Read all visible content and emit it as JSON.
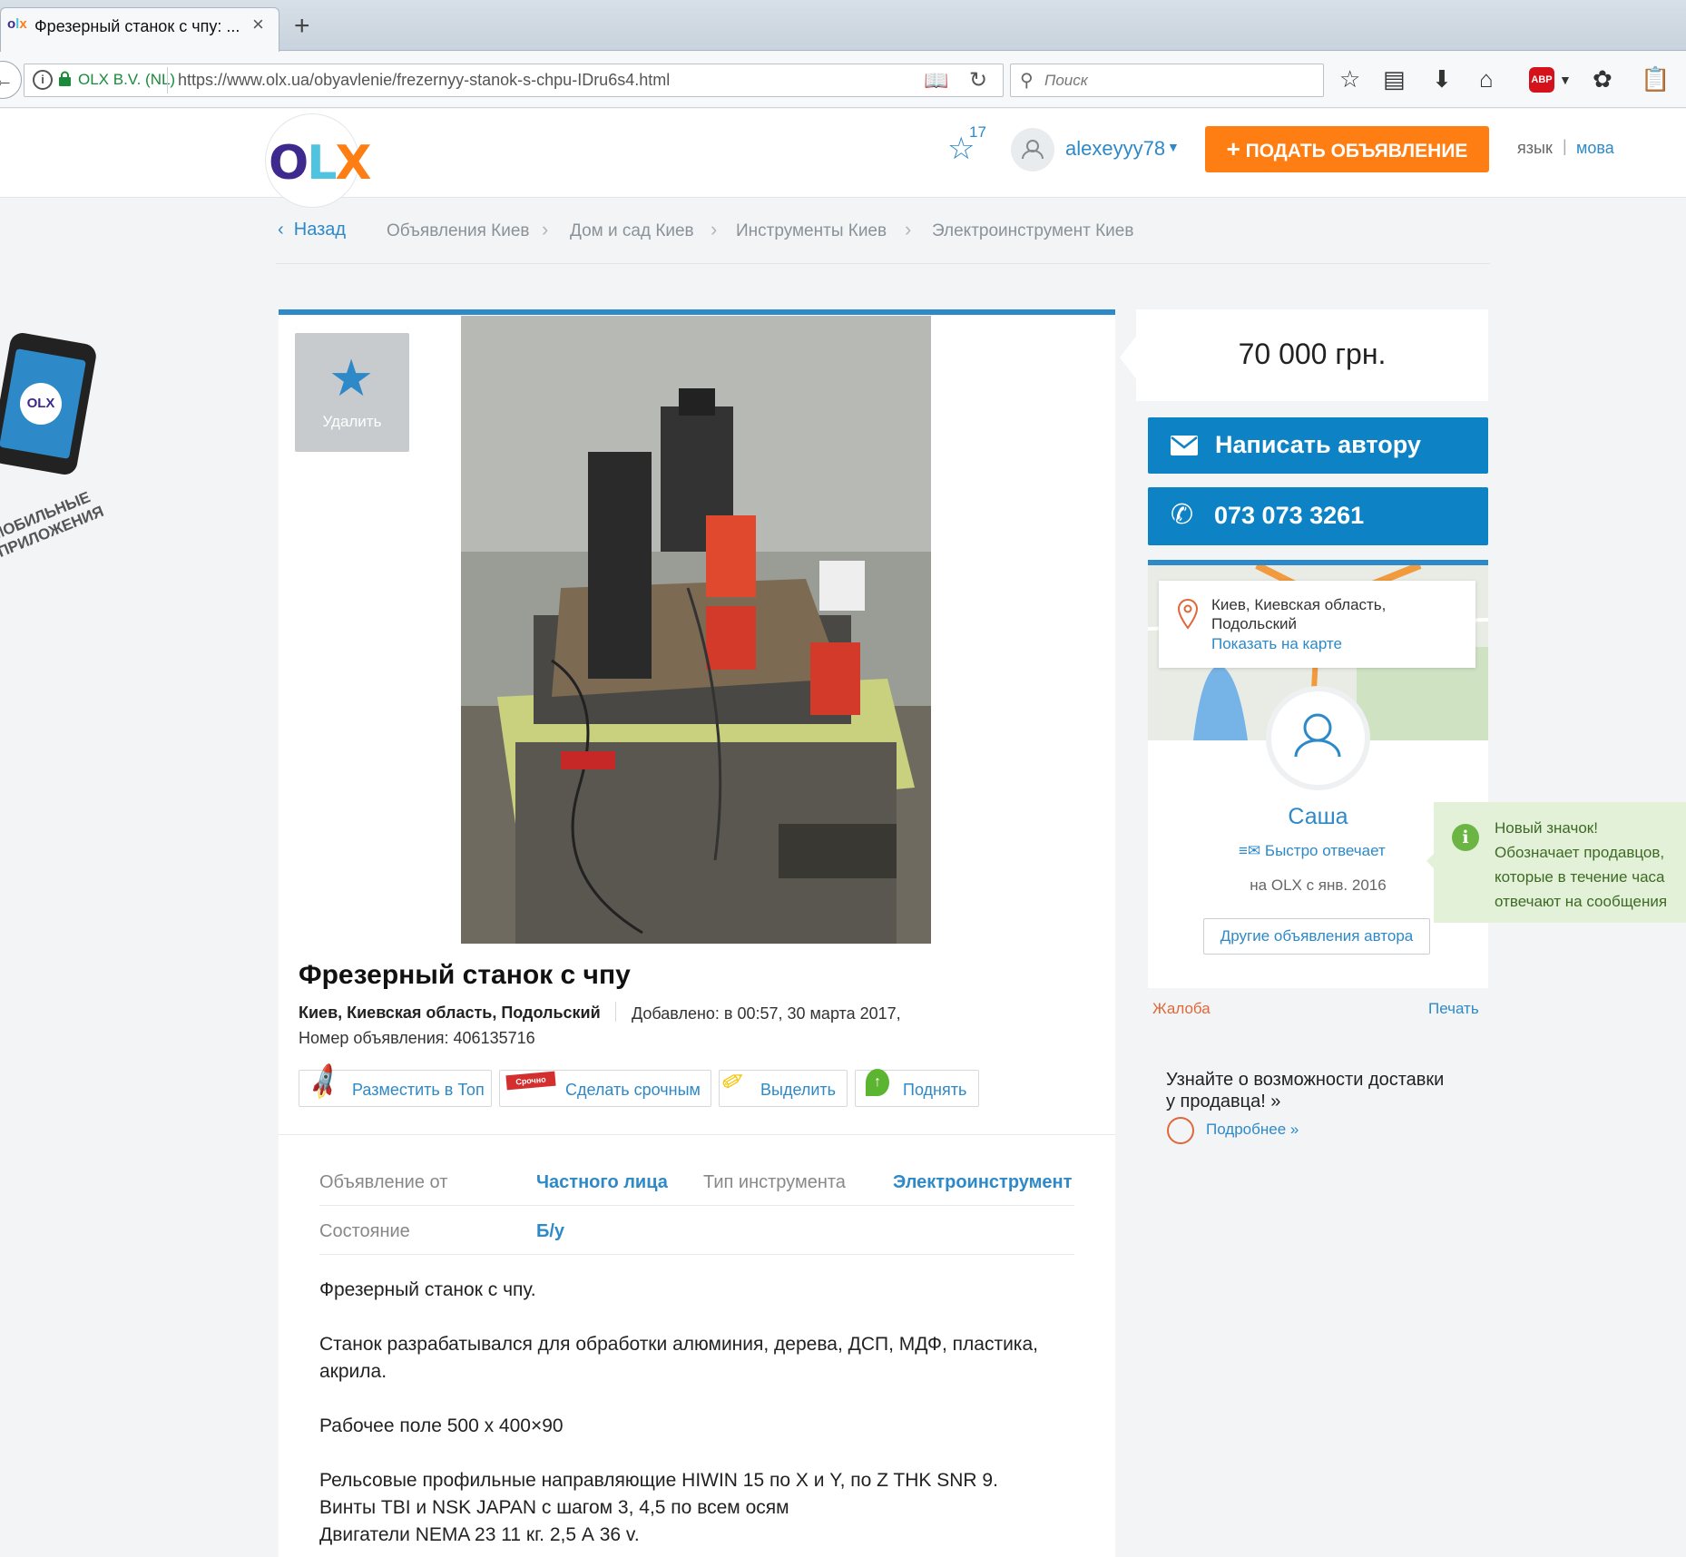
{
  "browser": {
    "tab_title": "Фрезерный станок с чпу: ...",
    "tab_favicon": "olx",
    "close_glyph": "×",
    "newtab_glyph": "+",
    "site_identity": "OLX B.V. (NL)",
    "url": "https://www.olx.ua/obyavlenie/frezernyy-stanok-s-chpu-IDru6s4.html",
    "search_placeholder": "Поиск"
  },
  "header": {
    "logo": {
      "o": "O",
      "l": "L",
      "x": "X",
      "colors": [
        "#3e2a8e",
        "#4fc3e0",
        "#ff7e14"
      ]
    },
    "favorites_count": "17",
    "username": "alexeyyy78",
    "post_button": "ПОДАТЬ ОБЪЯВЛЕНИЕ",
    "lang_ru": "язык",
    "lang_sep": "|",
    "lang_ua": "мова"
  },
  "breadcrumb": {
    "back": "Назад",
    "items": [
      "Объявления Киев",
      "Дом и сад Киев",
      "Инструменты Киев",
      "Электроинструмент Киев"
    ]
  },
  "promo": {
    "app_text": "МОБИЛЬНЫЕ ПРИЛОЖЕНИЯ",
    "logo_text": "OLX"
  },
  "ad": {
    "favorite_label": "Удалить",
    "title": "Фрезерный станок с чпу",
    "location": "Киев, Киевская область, Подольский",
    "added": "Добавлено: в 00:57, 30 марта 2017,",
    "ad_number": "Номер объявления: 406135716",
    "promote": {
      "top": "Разместить в Топ",
      "urgent": "Сделать срочным",
      "urgent_badge": "Срочно",
      "highlight": "Выделить",
      "bump": "Поднять"
    },
    "params": [
      {
        "label": "Объявление от",
        "value": "Частного лица"
      },
      {
        "label": "Тип инструмента",
        "value": "Электроинструмент"
      },
      {
        "label": "Состояние",
        "value": "Б/у"
      }
    ],
    "description": [
      "Фрезерный станок с чпу.",
      "Станок разрабатывался для обработки алюминия, дерева, ДСП, МДФ, пластика,",
      "акрила.",
      "Рабочее поле 500 х 400×90",
      "Рельсовые профильные направляющие HIWIN 15 по X и Y, по Z THK SNR 9.",
      "Винты TBI и NSK JAPAN с шагом 3, 4,5 по всем осям",
      "Двигатели NEMA 23 11 кг. 2,5 А 36 v."
    ]
  },
  "sidebar": {
    "price": "70 000 грн.",
    "write_author": "Написать автору",
    "phone": "073 073 3261",
    "address_line1": "Киев, Киевская область,",
    "address_line2": "Подольский",
    "show_map": "Показать на карте",
    "seller_name": "Саша",
    "quick_response": "Быстро отвечает",
    "member_since": "на OLX с янв. 2016",
    "other_ads": "Другие объявления автора",
    "complain": "Жалоба",
    "print": "Печать",
    "delivery_line1": "Узнайте о возможности доставки",
    "delivery_line2": "у продавца! »",
    "delivery_link": "Подробнее »"
  },
  "tooltip": {
    "icon": "i",
    "lines": [
      "Новый значок!",
      "Обозначает продавцов,",
      "которые в течение часа",
      "отвечают на сообщения"
    ]
  },
  "colors": {
    "accent": "#2d89c8",
    "button_blue": "#0d82c5",
    "orange": "#ff7e14",
    "tooltip_bg": "#e3f1d8"
  }
}
